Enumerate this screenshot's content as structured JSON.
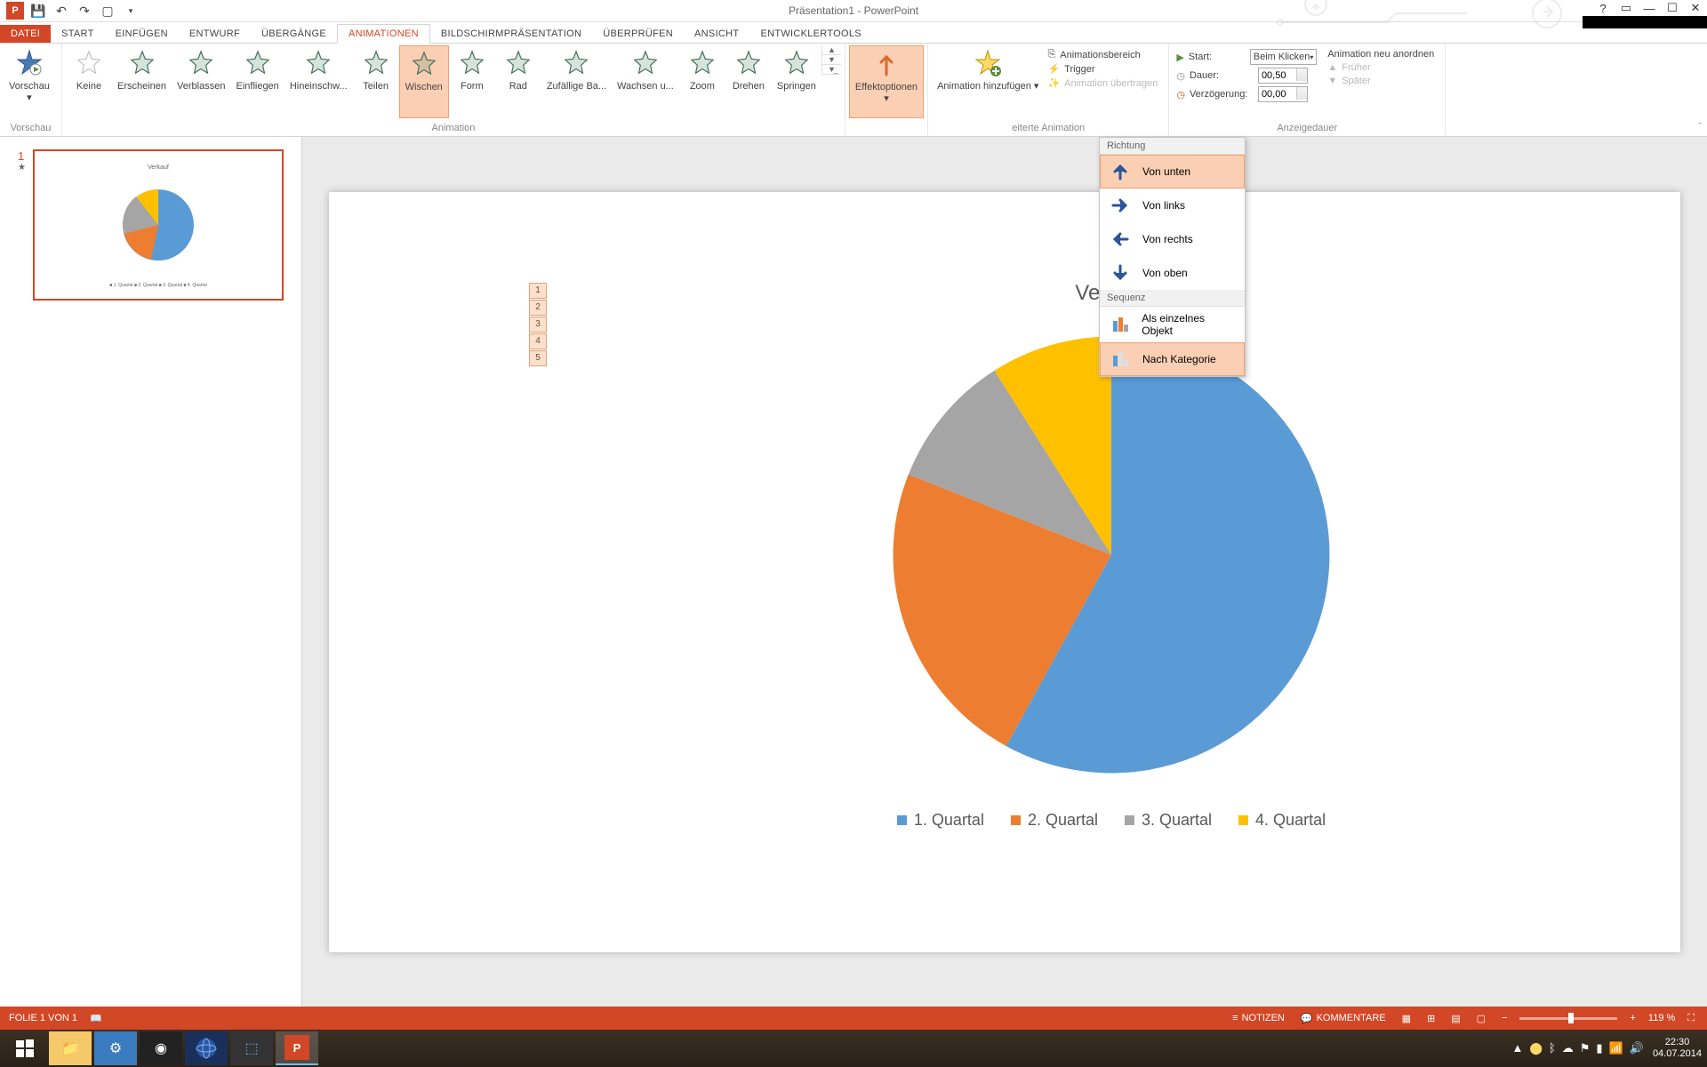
{
  "title": "Präsentation1 - PowerPoint",
  "tabs": {
    "file": "DATEI",
    "start": "START",
    "insert": "EINFÜGEN",
    "design": "ENTWURF",
    "transitions": "ÜBERGÄNGE",
    "animations": "ANIMATIONEN",
    "slideshow": "BILDSCHIRMPRÄSENTATION",
    "review": "ÜBERPRÜFEN",
    "view": "ANSICHT",
    "developer": "ENTWICKLERTOOLS"
  },
  "ribbon": {
    "preview": "Vorschau",
    "preview_group": "Vorschau",
    "animation_group": "Animation",
    "advanced_group": "eiterte Animation",
    "timing_group": "Anzeigedauer",
    "animations": {
      "none": "Keine",
      "appear": "Erscheinen",
      "fade": "Verblassen",
      "fly_in": "Einfliegen",
      "float_in": "Hineinschw...",
      "split": "Teilen",
      "wipe": "Wischen",
      "shape": "Form",
      "wheel": "Rad",
      "random": "Zufällige Ba...",
      "grow": "Wachsen u...",
      "zoom": "Zoom",
      "spin": "Drehen",
      "bounce": "Springen"
    },
    "effect_options": "Effektoptionen",
    "add_animation": "Animation hinzufügen",
    "anim_pane": "Animationsbereich",
    "trigger": "Trigger",
    "anim_painter": "Animation übertragen",
    "start_label": "Start:",
    "start_value": "Beim Klicken",
    "duration_label": "Dauer:",
    "duration_value": "00,50",
    "delay_label": "Verzögerung:",
    "delay_value": "00,00",
    "reorder": "Animation neu anordnen",
    "earlier": "Früher",
    "later": "Später"
  },
  "dropdown": {
    "direction_header": "Richtung",
    "from_bottom": "Von unten",
    "from_left": "Von links",
    "from_right": "Von rechts",
    "from_top": "Von oben",
    "sequence_header": "Sequenz",
    "as_one": "Als einzelnes Objekt",
    "by_category": "Nach Kategorie"
  },
  "anim_tags": [
    "1",
    "2",
    "3",
    "4",
    "5"
  ],
  "thumb_num": "1",
  "chart_data": {
    "type": "pie",
    "title": "Verkauf",
    "series": [
      {
        "name": "1. Quartal",
        "value": 58,
        "color": "#5b9bd5"
      },
      {
        "name": "2. Quartal",
        "value": 23,
        "color": "#ed7d31"
      },
      {
        "name": "3. Quartal",
        "value": 10,
        "color": "#a5a5a5"
      },
      {
        "name": "4. Quartal",
        "value": 9,
        "color": "#ffc000"
      }
    ]
  },
  "status": {
    "slide": "FOLIE 1 VON 1",
    "notes": "NOTIZEN",
    "comments": "KOMMENTARE",
    "zoom": "119 %"
  },
  "tray": {
    "time": "22:30",
    "date": "04.07.2014"
  }
}
